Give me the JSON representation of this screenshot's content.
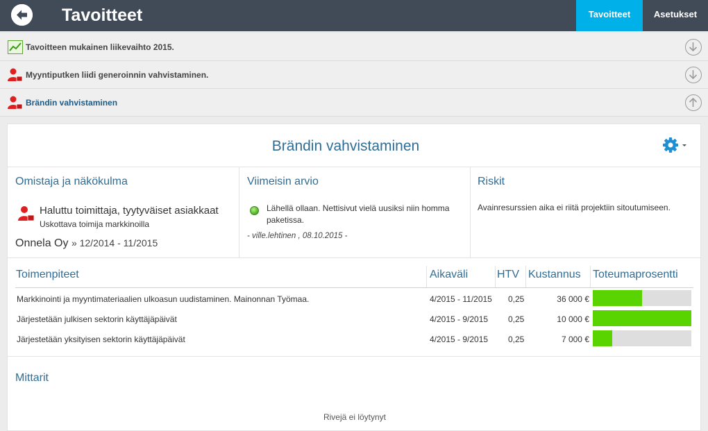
{
  "header": {
    "title": "Tavoitteet"
  },
  "nav": {
    "tabs": [
      {
        "label": "Tavoitteet",
        "active": true
      },
      {
        "label": "Asetukset",
        "active": false
      }
    ]
  },
  "goals": [
    {
      "label": "Tavoitteen mukainen liikevaihto 2015.",
      "icon": "chart-icon",
      "expanded": false
    },
    {
      "label": "Myyntiputken liidi generoinnin vahvistaminen.",
      "icon": "person-icon",
      "expanded": false
    },
    {
      "label": "Brändin vahvistaminen",
      "icon": "person-icon",
      "expanded": true
    }
  ],
  "detail": {
    "title": "Brändin vahvistaminen",
    "owner": {
      "heading": "Omistaja ja näkökulma",
      "perspective": "Haluttu toimittaja, tyytyväiset asiakkaat",
      "subtitle": "Uskottava toimija markkinoilla",
      "company": "Onnela Oy",
      "period": "» 12/2014 - 11/2015"
    },
    "review": {
      "heading": "Viimeisin arvio",
      "status_color": "#56b82b",
      "text": "Lähellä ollaan. Nettisivut vielä uusiksi niin homma paketissa.",
      "author": "- ville.lehtinen , 08.10.2015 -"
    },
    "risks": {
      "heading": "Riskit",
      "text": "Avainresurssien aika ei riitä projektiin sitoutumiseen."
    },
    "actions": {
      "columns": [
        "Toimenpiteet",
        "Aikaväli",
        "HTV",
        "Kustannus",
        "Toteumaprosentti"
      ],
      "rows": [
        {
          "name": "Markkinointi ja myyntimateriaalien ulkoasun uudistaminen. Mainonnan Työmaa.",
          "period": "4/2015 - 11/2015",
          "htv": "0,25",
          "cost": "36 000 €",
          "progress": 0.5
        },
        {
          "name": "Järjestetään julkisen sektorin käyttäjäpäivät",
          "period": "4/2015 - 9/2015",
          "htv": "0,25",
          "cost": "10 000 €",
          "progress": 1.0
        },
        {
          "name": "Järjestetään yksityisen sektorin käyttäjäpäivät",
          "period": "4/2015 - 9/2015",
          "htv": "0,25",
          "cost": "7 000 €",
          "progress": 0.2
        }
      ]
    },
    "metrics": {
      "heading": "Mittarit",
      "empty_text": "Rivejä ei löytynyt"
    }
  },
  "colors": {
    "topbar": "#414b57",
    "accent": "#00b0e8",
    "progress": "#59d400",
    "heading": "#2f6d94"
  }
}
